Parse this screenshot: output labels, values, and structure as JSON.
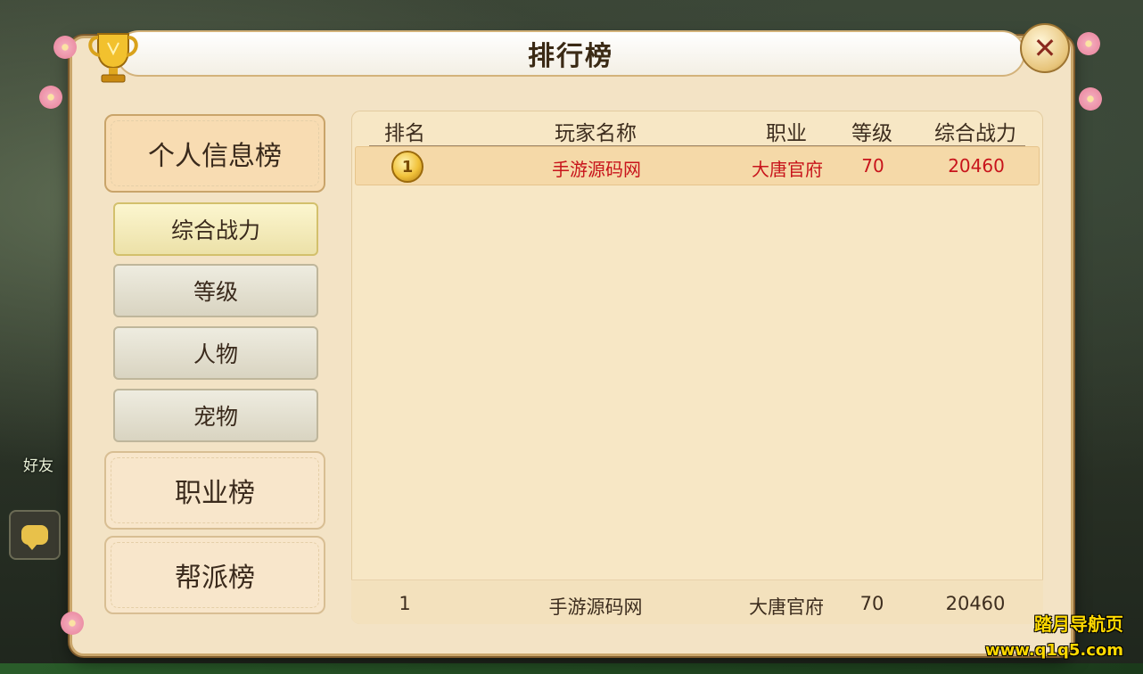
{
  "window": {
    "title": "排行榜"
  },
  "left_menu": {
    "categories": [
      {
        "label": "个人信息榜",
        "active": true
      },
      {
        "label": "职业榜",
        "active": false
      },
      {
        "label": "帮派榜",
        "active": false
      }
    ],
    "sub_items": [
      {
        "label": "综合战力",
        "active": true
      },
      {
        "label": "等级",
        "active": false
      },
      {
        "label": "人物",
        "active": false
      },
      {
        "label": "宠物",
        "active": false
      }
    ]
  },
  "table": {
    "headers": [
      "排名",
      "玩家名称",
      "职业",
      "等级",
      "综合战力"
    ],
    "rows": [
      {
        "rank": "1",
        "name": "手游源码网",
        "class": "大唐官府",
        "level": "70",
        "power": "20460"
      }
    ],
    "my_rank": {
      "rank": "1",
      "name": "手游源码网",
      "class": "大唐官府",
      "level": "70",
      "power": "20460"
    }
  },
  "background_ui": {
    "friend_label": "好友"
  },
  "icons": {
    "trophy": "trophy-icon",
    "close": "close-icon",
    "medal": "gold-medal-icon",
    "chat": "chat-bubble-icon"
  },
  "colors": {
    "highlight_text": "#c8141b",
    "panel_bg": "#f3e3c5",
    "watermark": "#ffd900"
  },
  "watermark": {
    "line1": "踏月导航页",
    "line2": "www.q1q5.com"
  }
}
